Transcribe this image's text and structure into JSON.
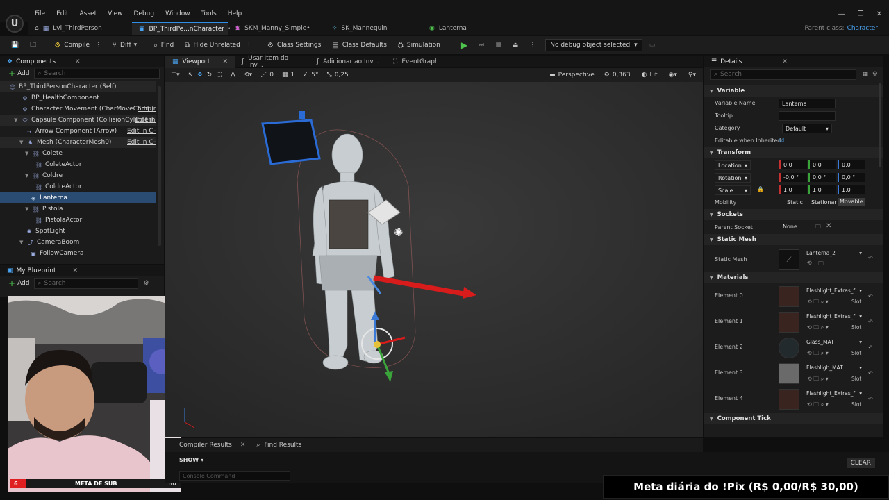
{
  "menu": [
    "File",
    "Edit",
    "Asset",
    "View",
    "Debug",
    "Window",
    "Tools",
    "Help"
  ],
  "tabs": [
    {
      "label": "Lvl_ThirdPerson",
      "icon": "level-icon",
      "active": false
    },
    {
      "label": "BP_ThirdPe...nCharacter",
      "icon": "blueprint-icon",
      "active": true,
      "modified": "•"
    },
    {
      "label": "SKM_Manny_Simple•",
      "icon": "skeletal-mesh-icon",
      "active": false
    },
    {
      "label": "SK_Mannequin",
      "icon": "skeleton-icon",
      "active": false
    },
    {
      "label": "Lanterna",
      "icon": "static-mesh-icon",
      "active": false
    }
  ],
  "parent_class": {
    "label": "Parent class:",
    "value": "Character"
  },
  "toolbar": {
    "compile": "Compile",
    "diff": "Diff",
    "find": "Find",
    "hide_unrelated": "Hide Unrelated",
    "class_settings": "Class Settings",
    "class_defaults": "Class Defaults",
    "simulation": "Simulation",
    "debug_object": "No debug object selected"
  },
  "components": {
    "title": "Components",
    "add": "Add",
    "search_placeholder": "Search",
    "edit_cpp": "Edit in C++",
    "edit_cpp_short": "Edit in C",
    "items": [
      {
        "label": "BP_ThirdPersonCharacter (Self)",
        "indent": 0
      },
      {
        "label": "BP_HealthComponent",
        "indent": 1
      },
      {
        "label": "Character Movement (CharMoveComp)",
        "indent": 1
      },
      {
        "label": "Capsule Component (CollisionCylinder)",
        "indent": 1
      },
      {
        "label": "Arrow Component (Arrow)",
        "indent": 2
      },
      {
        "label": "Mesh (CharacterMesh0)",
        "indent": 2
      },
      {
        "label": "Colete",
        "indent": 3
      },
      {
        "label": "ColeteActor",
        "indent": 4
      },
      {
        "label": "Coldre",
        "indent": 3
      },
      {
        "label": "ColdreActor",
        "indent": 4
      },
      {
        "label": "Lanterna",
        "indent": 3
      },
      {
        "label": "Pistola",
        "indent": 3
      },
      {
        "label": "PistolaActor",
        "indent": 4
      },
      {
        "label": "SpotLight",
        "indent": 2
      },
      {
        "label": "CameraBoom",
        "indent": 2
      },
      {
        "label": "FollowCamera",
        "indent": 3
      }
    ]
  },
  "my_blueprint": {
    "title": "My Blueprint",
    "add": "Add",
    "search_placeholder": "Search"
  },
  "viewport_tabs": [
    "Viewport",
    "Usar Item do Inv...",
    "Adicionar ao Inv...",
    "EventGraph"
  ],
  "viewport_toolbar": {
    "snap_rot": "0",
    "grid": "1",
    "angle": "5°",
    "scale": "0,25",
    "perspective": "Perspective",
    "speed": "0,363",
    "lit": "Lit"
  },
  "bottom": {
    "compiler_results": "Compiler Results",
    "find_results": "Find Results",
    "show": "SHOW",
    "console_placeholder": "Console Command",
    "clear": "CLEAR"
  },
  "details": {
    "title": "Details",
    "search_placeholder": "Search",
    "sections": {
      "variable": "Variable",
      "transform": "Transform",
      "sockets": "Sockets",
      "static_mesh": "Static Mesh",
      "materials": "Materials",
      "component_tick": "Component Tick"
    },
    "variable_name_label": "Variable Name",
    "variable_name": "Lanterna",
    "tooltip_label": "Tooltip",
    "category_label": "Category",
    "category": "Default",
    "editable_label": "Editable when Inherited",
    "location_label": "Location",
    "location": [
      "0,0",
      "0,0",
      "0,0"
    ],
    "rotation_label": "Rotation",
    "rotation": [
      "-0,0 °",
      "0,0 °",
      "0,0 °"
    ],
    "scale_label": "Scale",
    "scale": [
      "1,0",
      "1,0",
      "1,0"
    ],
    "mobility_label": "Mobility",
    "mobility": [
      "Static",
      "Stationar",
      "Movable"
    ],
    "parent_socket_label": "Parent Socket",
    "parent_socket": "None",
    "static_mesh_label": "Static Mesh",
    "static_mesh": "Lanterna_2",
    "slot": "Slot",
    "materials": [
      {
        "label": "Element 0",
        "name": "Flashlight_Extras_f"
      },
      {
        "label": "Element 1",
        "name": "Flashlight_Extras_f"
      },
      {
        "label": "Element 2",
        "name": "Glass_MAT"
      },
      {
        "label": "Element 3",
        "name": "Flashligh_MAT"
      },
      {
        "label": "Element 4",
        "name": "Flashlight_Extras_f"
      }
    ]
  },
  "overlay": {
    "pix": "Meta diária do !Pix (R$ 0,00/R$ 30,00)",
    "sub_label": "META DE SUB",
    "sub_current": "6",
    "sub_goal": "50"
  },
  "colors": {
    "accent": "#2f8fe8",
    "selection": "#2b4c72",
    "play": "#4ec34e"
  }
}
